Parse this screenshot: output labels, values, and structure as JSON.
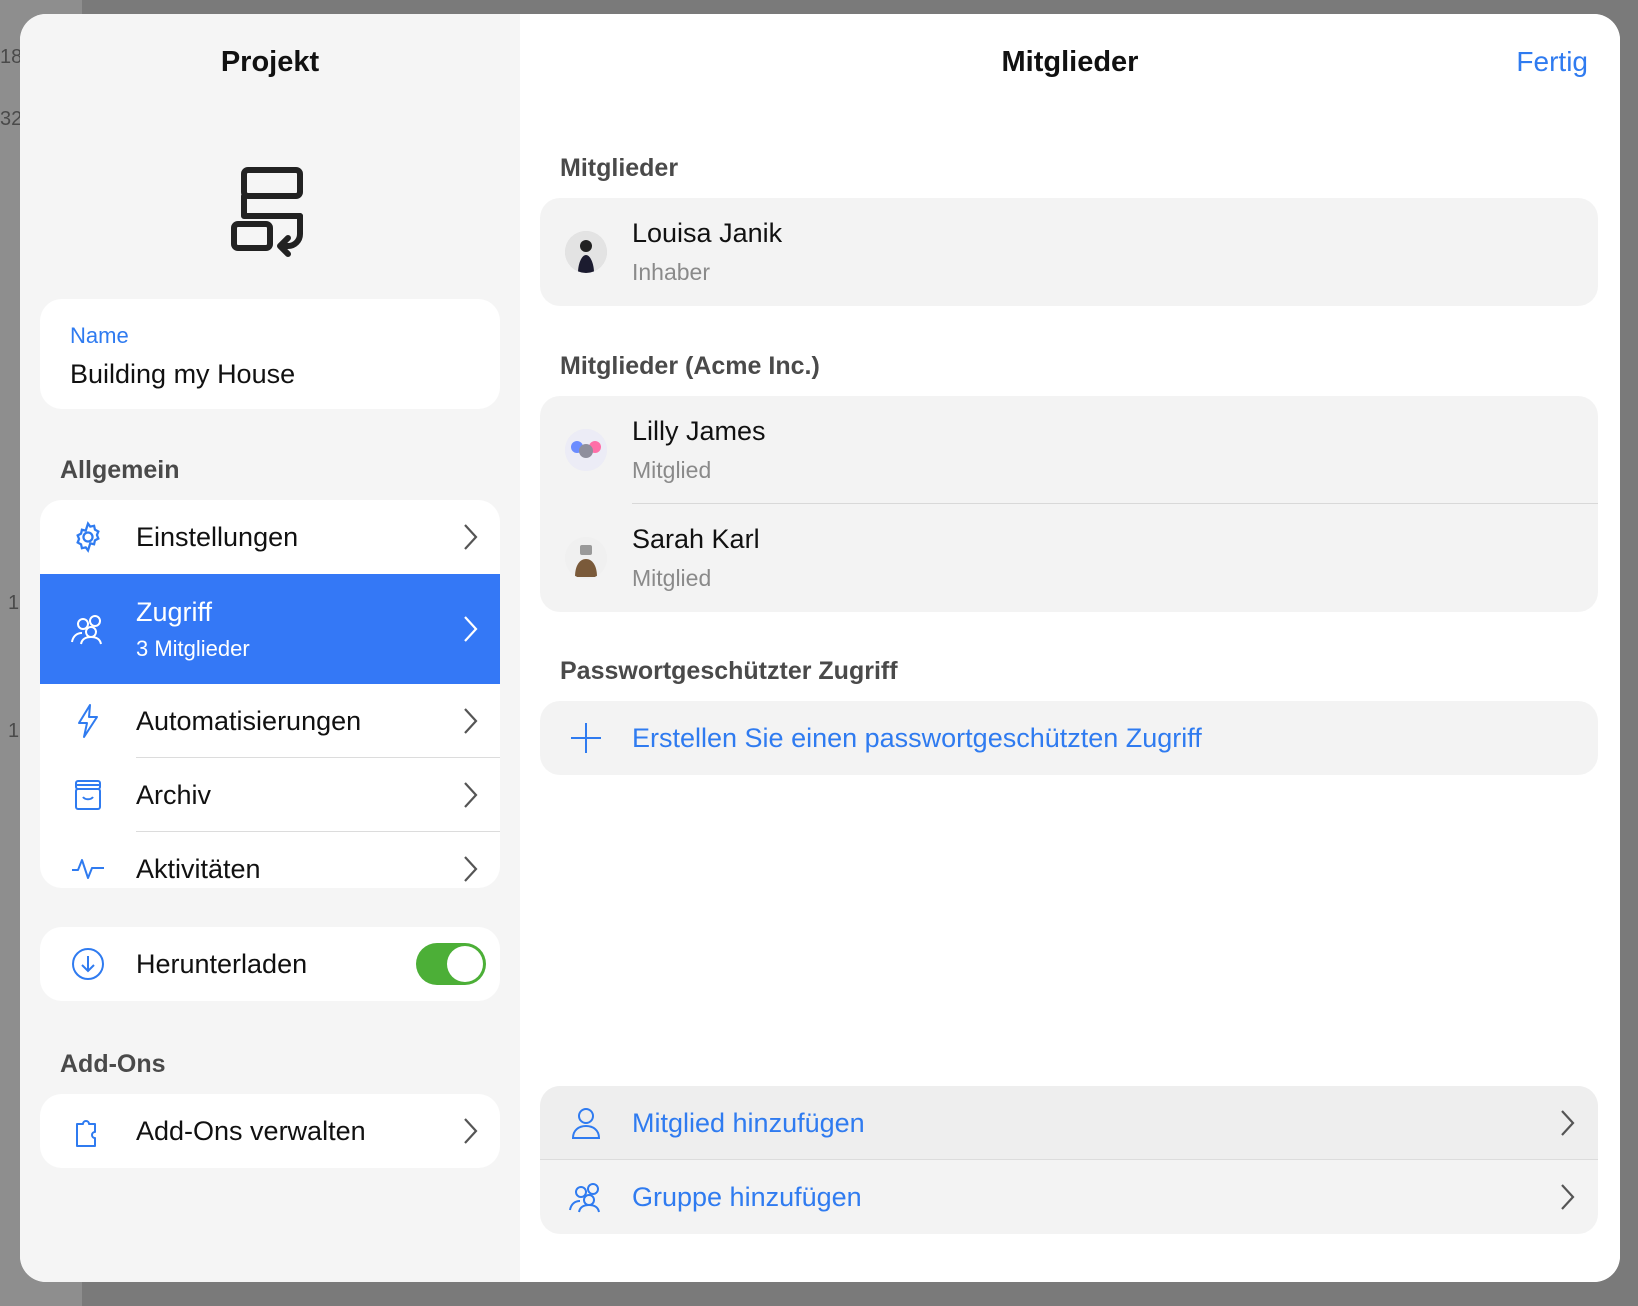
{
  "background": {
    "numbers": [
      "18",
      "32",
      "1",
      "1"
    ]
  },
  "left": {
    "title": "Projekt",
    "name_field": {
      "label": "Name",
      "value": "Building my House"
    },
    "general_section": "Allgemein",
    "items": [
      {
        "label": "Einstellungen",
        "icon": "gear-icon"
      },
      {
        "label": "Zugriff",
        "sub": "3 Mitglieder",
        "icon": "group-icon",
        "active": true
      },
      {
        "label": "Automatisierungen",
        "icon": "bolt-icon"
      },
      {
        "label": "Archiv",
        "icon": "archive-icon"
      },
      {
        "label": "Aktivitäten",
        "icon": "activity-icon"
      }
    ],
    "download": {
      "label": "Herunterladen",
      "enabled": true
    },
    "addons_section": "Add-Ons",
    "addons_item": {
      "label": "Add-Ons verwalten",
      "icon": "puzzle-icon"
    }
  },
  "right": {
    "title": "Mitglieder",
    "done": "Fertig",
    "owners_section": "Mitglieder",
    "owners": [
      {
        "name": "Louisa Janik",
        "role": "Inhaber"
      }
    ],
    "acme_section": "Mitglieder (Acme Inc.)",
    "acme_members": [
      {
        "name": "Lilly James",
        "role": "Mitglied"
      },
      {
        "name": "Sarah Karl",
        "role": "Mitglied"
      }
    ],
    "password_section": "Passwortgeschützter Zugriff",
    "password_action": "Erstellen Sie einen passwortgeschützten Zugriff",
    "add_member": "Mitglied hinzufügen",
    "add_group": "Gruppe hinzufügen"
  },
  "colors": {
    "accent": "#3478f6",
    "link": "#2f7bf0",
    "toggle_on": "#4caf37"
  }
}
